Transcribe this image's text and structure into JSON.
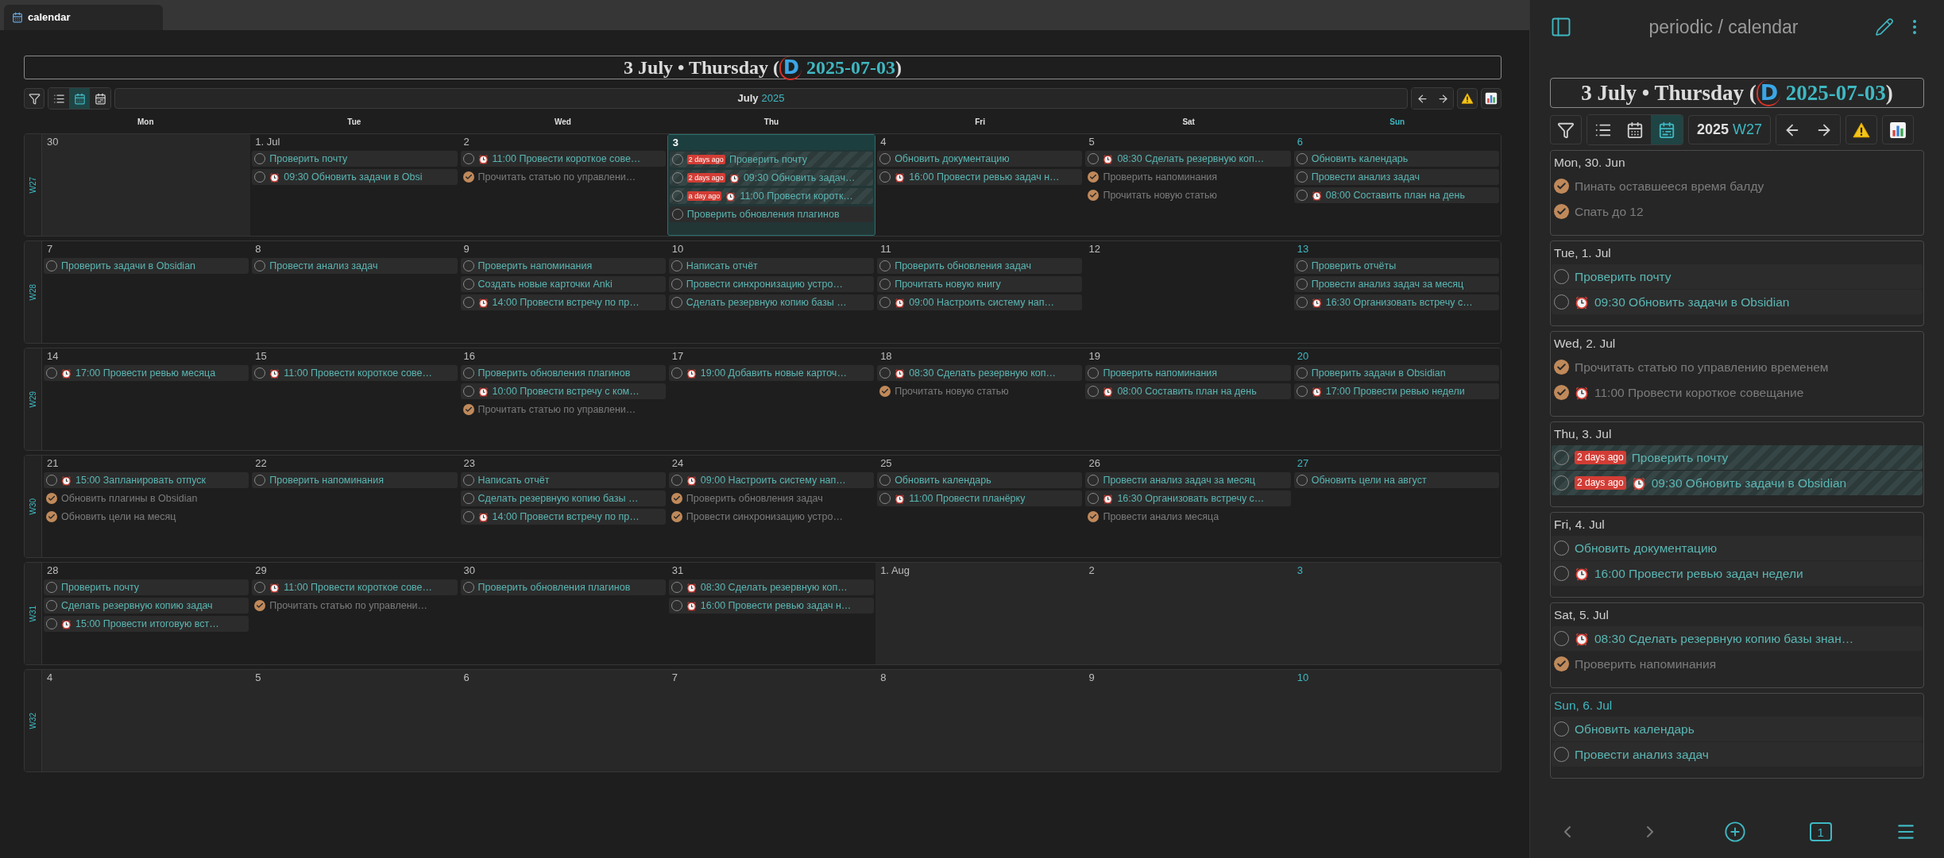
{
  "tab": {
    "title": "calendar"
  },
  "header": {
    "title": "3 July • Thursday (",
    "logo": "D",
    "date": "2025-07-03",
    "close": ")"
  },
  "toolbar": {
    "views": [
      {
        "kind": "list",
        "selected": false
      },
      {
        "kind": "month",
        "selected": true
      },
      {
        "kind": "week",
        "selected": false
      }
    ],
    "month": "July",
    "year": "2025"
  },
  "weekdays": [
    {
      "label": "Mon",
      "weekend": false
    },
    {
      "label": "Tue",
      "weekend": false
    },
    {
      "label": "Wed",
      "weekend": false
    },
    {
      "label": "Thu",
      "weekend": false
    },
    {
      "label": "Fri",
      "weekend": false
    },
    {
      "label": "Sat",
      "weekend": false
    },
    {
      "label": "Sun",
      "weekend": true
    }
  ],
  "weeks": [
    {
      "label": "W27",
      "days": [
        {
          "date": "30",
          "outside": true,
          "today": false
        },
        {
          "date": "1. Jul",
          "outside": false,
          "today": false,
          "tasks": [
            {
              "text": "Проверить почту",
              "checked": false,
              "overdue": false
            },
            {
              "time": "09:30",
              "text": "Обновить задачи в Obsi",
              "checked": false,
              "overdue": false
            }
          ]
        },
        {
          "date": "2",
          "outside": false,
          "today": false,
          "tasks": [
            {
              "time": "11:00",
              "text": "Провести короткое сове…",
              "checked": false,
              "overdue": false
            },
            {
              "text": "Прочитать статью по управлени…",
              "checked": true,
              "overdue": false
            }
          ]
        },
        {
          "date": "3",
          "outside": false,
          "today": true,
          "tasks": [
            {
              "badge": "2 days ago",
              "text": "Проверить почту",
              "checked": false,
              "overdue": true
            },
            {
              "badge": "2 days ago",
              "time": "09:30",
              "text": "Обновить задач…",
              "checked": false,
              "overdue": true
            },
            {
              "badge": "a day ago",
              "time": "11:00",
              "text": "Провести коротк…",
              "checked": false,
              "overdue": true
            },
            {
              "text": "Проверить обновления плагинов",
              "checked": false,
              "overdue": false
            }
          ]
        },
        {
          "date": "4",
          "outside": false,
          "today": false,
          "tasks": [
            {
              "text": "Обновить документацию",
              "checked": false,
              "overdue": false
            },
            {
              "time": "16:00",
              "text": "Провести ревью задач н…",
              "checked": false,
              "overdue": false
            }
          ]
        },
        {
          "date": "5",
          "outside": false,
          "today": false,
          "tasks": [
            {
              "time": "08:30",
              "text": "Сделать резервную коп…",
              "checked": false,
              "overdue": false
            },
            {
              "text": "Проверить напоминания",
              "checked": true,
              "overdue": false
            },
            {
              "text": "Прочитать новую статью",
              "checked": true,
              "overdue": false
            }
          ]
        },
        {
          "date": "6",
          "outside": false,
          "today": false,
          "tasks": [
            {
              "text": "Обновить календарь",
              "checked": false,
              "overdue": false
            },
            {
              "text": "Провести анализ задач",
              "checked": false,
              "overdue": false
            },
            {
              "time": "08:00",
              "text": "Составить план на день",
              "checked": false,
              "overdue": false
            }
          ]
        }
      ]
    },
    {
      "label": "W28",
      "days": [
        {
          "date": "7",
          "outside": false,
          "today": false,
          "tasks": [
            {
              "text": "Проверить задачи в Obsidian",
              "checked": false,
              "overdue": false
            }
          ]
        },
        {
          "date": "8",
          "outside": false,
          "today": false,
          "tasks": [
            {
              "text": "Провести анализ задач",
              "checked": false,
              "overdue": false
            }
          ]
        },
        {
          "date": "9",
          "outside": false,
          "today": false,
          "tasks": [
            {
              "text": "Проверить напоминания",
              "checked": false,
              "overdue": false
            },
            {
              "text": "Создать новые карточки Anki",
              "checked": false,
              "overdue": false
            },
            {
              "time": "14:00",
              "text": "Провести встречу по пр…",
              "checked": false,
              "overdue": false
            }
          ]
        },
        {
          "date": "10",
          "outside": false,
          "today": false,
          "tasks": [
            {
              "text": "Написать отчёт",
              "checked": false,
              "overdue": false
            },
            {
              "text": "Провести синхронизацию устро…",
              "checked": false,
              "overdue": false
            },
            {
              "text": "Сделать резервную копию базы …",
              "checked": false,
              "overdue": false
            }
          ]
        },
        {
          "date": "11",
          "outside": false,
          "today": false,
          "tasks": [
            {
              "text": "Проверить обновления задач",
              "checked": false,
              "overdue": false
            },
            {
              "text": "Прочитать новую книгу",
              "checked": false,
              "overdue": false
            },
            {
              "time": "09:00",
              "text": "Настроить систему нап…",
              "checked": false,
              "overdue": false
            }
          ]
        },
        {
          "date": "12",
          "outside": false,
          "today": false
        },
        {
          "date": "13",
          "outside": false,
          "today": false,
          "tasks": [
            {
              "text": "Проверить отчёты",
              "checked": false,
              "overdue": false
            },
            {
              "text": "Провести анализ задач за месяц",
              "checked": false,
              "overdue": false
            },
            {
              "time": "16:30",
              "text": "Организовать встречу с…",
              "checked": false,
              "overdue": false
            }
          ]
        }
      ]
    },
    {
      "label": "W29",
      "days": [
        {
          "date": "14",
          "outside": false,
          "today": false,
          "tasks": [
            {
              "time": "17:00",
              "text": "Провести ревью месяца",
              "checked": false,
              "overdue": false
            }
          ]
        },
        {
          "date": "15",
          "outside": false,
          "today": false,
          "tasks": [
            {
              "time": "11:00",
              "text": "Провести короткое сове…",
              "checked": false,
              "overdue": false
            }
          ]
        },
        {
          "date": "16",
          "outside": false,
          "today": false,
          "tasks": [
            {
              "text": "Проверить обновления плагинов",
              "checked": false,
              "overdue": false
            },
            {
              "time": "10:00",
              "text": "Провести встречу с ком…",
              "checked": false,
              "overdue": false
            },
            {
              "text": "Прочитать статью по управлени…",
              "checked": true,
              "overdue": false
            }
          ]
        },
        {
          "date": "17",
          "outside": false,
          "today": false,
          "tasks": [
            {
              "time": "19:00",
              "text": "Добавить новые карточ…",
              "checked": false,
              "overdue": false
            }
          ]
        },
        {
          "date": "18",
          "outside": false,
          "today": false,
          "tasks": [
            {
              "time": "08:30",
              "text": "Сделать резервную коп…",
              "checked": false,
              "overdue": false
            },
            {
              "text": "Прочитать новую статью",
              "checked": true,
              "overdue": false
            }
          ]
        },
        {
          "date": "19",
          "outside": false,
          "today": false,
          "tasks": [
            {
              "text": "Проверить напоминания",
              "checked": false,
              "overdue": false
            },
            {
              "time": "08:00",
              "text": "Составить план на день",
              "checked": false,
              "overdue": false
            }
          ]
        },
        {
          "date": "20",
          "outside": false,
          "today": false,
          "tasks": [
            {
              "text": "Проверить задачи в Obsidian",
              "checked": false,
              "overdue": false
            },
            {
              "time": "17:00",
              "text": "Провести ревью недели",
              "checked": false,
              "overdue": false
            }
          ]
        }
      ]
    },
    {
      "label": "W30",
      "days": [
        {
          "date": "21",
          "outside": false,
          "today": false,
          "tasks": [
            {
              "time": "15:00",
              "text": "Запланировать отпуск",
              "checked": false,
              "overdue": false
            },
            {
              "text": "Обновить плагины в Obsidian",
              "checked": true,
              "overdue": false
            },
            {
              "text": "Обновить цели на месяц",
              "checked": true,
              "overdue": false
            }
          ]
        },
        {
          "date": "22",
          "outside": false,
          "today": false,
          "tasks": [
            {
              "text": "Проверить напоминания",
              "checked": false,
              "overdue": false
            }
          ]
        },
        {
          "date": "23",
          "outside": false,
          "today": false,
          "tasks": [
            {
              "text": "Написать отчёт",
              "checked": false,
              "overdue": false
            },
            {
              "text": "Сделать резервную копию базы …",
              "checked": false,
              "overdue": false
            },
            {
              "time": "14:00",
              "text": "Провести встречу по пр…",
              "checked": false,
              "overdue": false
            }
          ]
        },
        {
          "date": "24",
          "outside": false,
          "today": false,
          "tasks": [
            {
              "time": "09:00",
              "text": "Настроить систему нап…",
              "checked": false,
              "overdue": false
            },
            {
              "text": "Проверить обновления задач",
              "checked": true,
              "overdue": false
            },
            {
              "text": "Провести синхронизацию устро…",
              "checked": true,
              "overdue": false
            }
          ]
        },
        {
          "date": "25",
          "outside": false,
          "today": false,
          "tasks": [
            {
              "text": "Обновить календарь",
              "checked": false,
              "overdue": false
            },
            {
              "time": "11:00",
              "text": "Провести планёрку",
              "checked": false,
              "overdue": false
            }
          ]
        },
        {
          "date": "26",
          "outside": false,
          "today": false,
          "tasks": [
            {
              "text": "Провести анализ задач за месяц",
              "checked": false,
              "overdue": false
            },
            {
              "time": "16:30",
              "text": "Организовать встречу с…",
              "checked": false,
              "overdue": false
            },
            {
              "text": "Провести анализ месяца",
              "checked": true,
              "overdue": false
            }
          ]
        },
        {
          "date": "27",
          "outside": false,
          "today": false,
          "tasks": [
            {
              "text": "Обновить цели на август",
              "checked": false,
              "overdue": false
            }
          ]
        }
      ]
    },
    {
      "label": "W31",
      "days": [
        {
          "date": "28",
          "outside": false,
          "today": false,
          "tasks": [
            {
              "text": "Проверить почту",
              "checked": false,
              "overdue": false
            },
            {
              "text": "Сделать резервную копию задач",
              "checked": false,
              "overdue": false
            },
            {
              "time": "15:00",
              "text": "Провести итоговую вст…",
              "checked": false,
              "overdue": false
            }
          ]
        },
        {
          "date": "29",
          "outside": false,
          "today": false,
          "tasks": [
            {
              "time": "11:00",
              "text": "Провести короткое сове…",
              "checked": false,
              "overdue": false
            },
            {
              "text": "Прочитать статью по управлени…",
              "checked": true,
              "overdue": false
            }
          ]
        },
        {
          "date": "30",
          "outside": false,
          "today": false,
          "tasks": [
            {
              "text": "Проверить обновления плагинов",
              "checked": false,
              "overdue": false
            }
          ]
        },
        {
          "date": "31",
          "outside": false,
          "today": false,
          "tasks": [
            {
              "time": "08:30",
              "text": "Сделать резервную коп…",
              "checked": false,
              "overdue": false
            },
            {
              "time": "16:00",
              "text": "Провести ревью задач н…",
              "checked": false,
              "overdue": false
            }
          ]
        },
        {
          "date": "1. Aug",
          "outside": true,
          "today": false
        },
        {
          "date": "2",
          "outside": true,
          "today": false
        },
        {
          "date": "3",
          "outside": true,
          "today": false
        }
      ]
    },
    {
      "label": "W32",
      "days": [
        {
          "date": "4",
          "outside": true,
          "today": false
        },
        {
          "date": "5",
          "outside": true,
          "today": false
        },
        {
          "date": "6",
          "outside": true,
          "today": false
        },
        {
          "date": "7",
          "outside": true,
          "today": false
        },
        {
          "date": "8",
          "outside": true,
          "today": false
        },
        {
          "date": "9",
          "outside": true,
          "today": false
        },
        {
          "date": "10",
          "outside": true,
          "today": false
        }
      ]
    }
  ],
  "panel": {
    "title": "periodic / calendar",
    "header": {
      "title": "3 July • Thursday (",
      "logo": "D",
      "date": "2025-07-03",
      "close": ")"
    },
    "toolbar": {
      "views": [
        {
          "kind": "list",
          "selected": false
        },
        {
          "kind": "month",
          "selected": false
        },
        {
          "kind": "week",
          "selected": true
        }
      ],
      "year": "2025",
      "week": "W27"
    },
    "sections": [
      {
        "heading": "Mon, 30. Jun",
        "weekend": false,
        "tasks": [
          {
            "text": "Пинать оставшееся время балду",
            "checked": true,
            "overdue": false
          },
          {
            "text": "Спать до 12",
            "checked": true,
            "overdue": false
          }
        ]
      },
      {
        "heading": "Tue, 1. Jul",
        "weekend": false,
        "tasks": [
          {
            "text": "Проверить почту",
            "checked": false,
            "overdue": false
          },
          {
            "time": "09:30",
            "text": "Обновить задачи в Obsidian",
            "checked": false,
            "overdue": false
          }
        ]
      },
      {
        "heading": "Wed, 2. Jul",
        "weekend": false,
        "tasks": [
          {
            "text": "Прочитать статью по управлению временем",
            "checked": true,
            "overdue": false
          },
          {
            "time": "11:00",
            "text": "Провести короткое совещание",
            "checked": true,
            "overdue": false
          }
        ]
      },
      {
        "heading": "Thu, 3. Jul",
        "weekend": false,
        "tasks": [
          {
            "badge": "2 days ago",
            "text": "Проверить почту",
            "checked": false,
            "overdue": true
          },
          {
            "badge": "2 days ago",
            "time": "09:30",
            "text": "Обновить задачи в Obsidian",
            "checked": false,
            "overdue": true
          }
        ]
      },
      {
        "heading": "Fri, 4. Jul",
        "weekend": false,
        "tasks": [
          {
            "text": "Обновить документацию",
            "checked": false,
            "overdue": false
          },
          {
            "time": "16:00",
            "text": "Провести ревью задач недели",
            "checked": false,
            "overdue": false
          }
        ]
      },
      {
        "heading": "Sat, 5. Jul",
        "weekend": false,
        "tasks": [
          {
            "time": "08:30",
            "text": "Сделать резервную копию базы знан…",
            "checked": false,
            "overdue": false
          },
          {
            "text": "Проверить напоминания",
            "checked": true,
            "overdue": false
          }
        ]
      },
      {
        "heading": "Sun, 6. Jul",
        "weekend": true,
        "tasks": [
          {
            "text": "Обновить календарь",
            "checked": false,
            "overdue": false
          },
          {
            "text": "Провести анализ задач",
            "checked": false,
            "overdue": false
          }
        ]
      }
    ],
    "page": "1"
  }
}
